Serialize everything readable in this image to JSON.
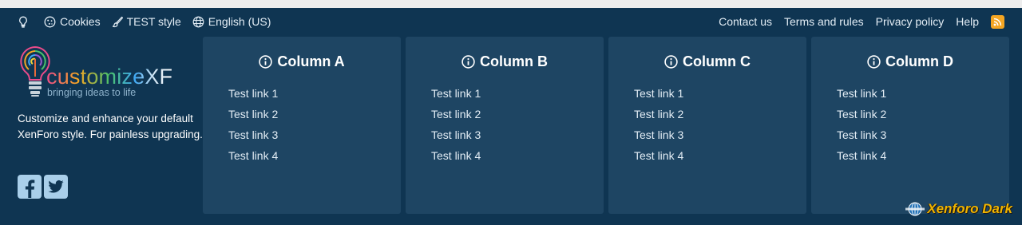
{
  "navbar": {
    "left": [
      {
        "icon": "lightbulb-icon",
        "label": ""
      },
      {
        "icon": "cookie-icon",
        "label": "Cookies"
      },
      {
        "icon": "paintbrush-icon",
        "label": "TEST style"
      },
      {
        "icon": "globe-icon",
        "label": "English (US)"
      }
    ],
    "right": [
      {
        "label": "Contact us"
      },
      {
        "label": "Terms and rules"
      },
      {
        "label": "Privacy policy"
      },
      {
        "label": "Help"
      }
    ],
    "rss_icon": "rss-icon",
    "rss_color": "#f5a623"
  },
  "brand": {
    "logo_word": "customizeXF",
    "logo_tagline": "bringing ideas to life",
    "description": "Customize and enhance your default XenForo style. For painless upgrading.",
    "social": [
      {
        "icon": "facebook-icon"
      },
      {
        "icon": "twitter-icon"
      }
    ]
  },
  "columns": [
    {
      "title": "Column A",
      "icon": "info-circle-icon",
      "links": [
        "Test link 1",
        "Test link 2",
        "Test link 3",
        "Test link 4"
      ]
    },
    {
      "title": "Column B",
      "icon": "info-circle-icon",
      "links": [
        "Test link 1",
        "Test link 2",
        "Test link 3",
        "Test link 4"
      ]
    },
    {
      "title": "Column C",
      "icon": "info-circle-icon",
      "links": [
        "Test link 1",
        "Test link 2",
        "Test link 3",
        "Test link 4"
      ]
    },
    {
      "title": "Column D",
      "icon": "info-circle-icon",
      "links": [
        "Test link 1",
        "Test link 2",
        "Test link 3",
        "Test link 4"
      ]
    }
  ],
  "badge": {
    "text": "Xenforo Dark",
    "icon": "globe-badge-icon"
  },
  "colors": {
    "background": "#0f3552",
    "panel": "#1e4563",
    "social_button": "#a9cfea",
    "badge_text": "#f0b400"
  }
}
